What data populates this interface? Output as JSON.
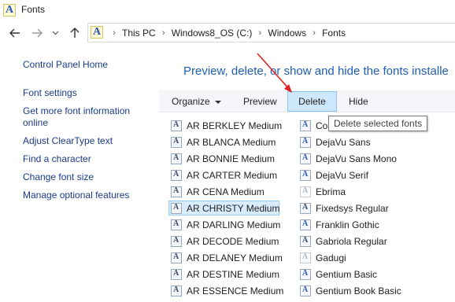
{
  "window": {
    "title": "Fonts"
  },
  "address": {
    "crumbs": [
      "This PC",
      "Windows8_OS (C:)",
      "Windows",
      "Fonts"
    ]
  },
  "left_pane": {
    "links": [
      "Control Panel Home",
      "Font settings",
      "Get more font information online",
      "Adjust ClearType text",
      "Find a character",
      "Change font size",
      "Manage optional features"
    ]
  },
  "main": {
    "heading": "Preview, delete, or show and hide the fonts installe"
  },
  "toolbar": {
    "organize_label": "Organize",
    "preview_label": "Preview",
    "delete_label": "Delete",
    "hide_label": "Hide"
  },
  "tooltip": {
    "text": "Delete selected fonts"
  },
  "fonts": {
    "col1": [
      "AR BERKLEY Medium",
      "AR BLANCA Medium",
      "AR BONNIE Medium",
      "AR CARTER Medium",
      "AR CENA Medium",
      "AR CHRISTY Medium",
      "AR DARLING Medium",
      "AR DECODE Medium",
      "AR DELANEY Medium",
      "AR DESTINE Medium",
      "AR ESSENCE Medium"
    ],
    "col2": [
      "Co",
      "DejaVu Sans",
      "DejaVu Sans Mono",
      "DejaVu Serif",
      "Ebrima",
      "Fixedsys Regular",
      "Franklin Gothic",
      "Gabriola Regular",
      "Gadugi",
      "Gentium Basic",
      "Gentium Book Basic"
    ],
    "selected": "AR CHRISTY Medium"
  },
  "colors": {
    "link": "#1a3c8b",
    "heading": "#1e5fb4",
    "active_button": "#cde8fb",
    "selection": "#d9ecfb",
    "annotation_arrow": "#e02020"
  }
}
